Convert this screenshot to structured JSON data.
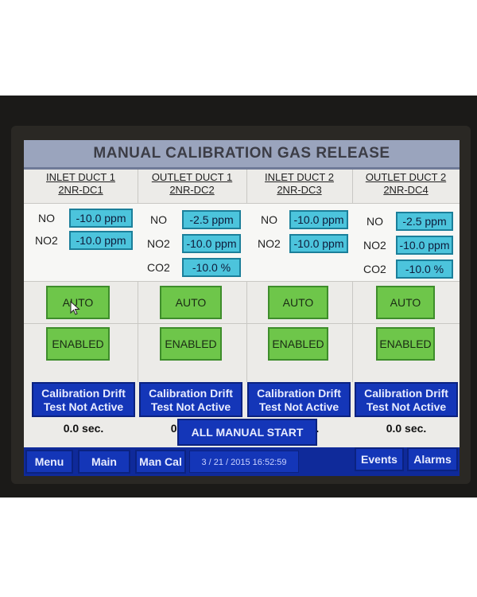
{
  "title": "MANUAL CALIBRATION GAS RELEASE",
  "ducts": [
    {
      "name": "INLET DUCT 1",
      "id": "2NR-DC1",
      "gases": [
        {
          "label": "NO",
          "value": "-10.0 ppm"
        },
        {
          "label": "NO2",
          "value": "-10.0 ppm"
        }
      ],
      "mode": "AUTO",
      "state": "ENABLED",
      "drift_status": [
        "Calibration Drift",
        "Test Not Active"
      ],
      "timer": "0.0 sec."
    },
    {
      "name": "OUTLET DUCT 1",
      "id": "2NR-DC2",
      "gases": [
        {
          "label": "NO",
          "value": "-2.5 ppm"
        },
        {
          "label": "NO2",
          "value": "-10.0 ppm"
        },
        {
          "label": "CO2",
          "value": "-10.0 %"
        }
      ],
      "mode": "AUTO",
      "state": "ENABLED",
      "drift_status": [
        "Calibration Drift",
        "Test Not Active"
      ],
      "timer": "0.0 sec."
    },
    {
      "name": "INLET DUCT 2",
      "id": "2NR-DC3",
      "gases": [
        {
          "label": "NO",
          "value": "-10.0 ppm"
        },
        {
          "label": "NO2",
          "value": "-10.0 ppm"
        }
      ],
      "mode": "AUTO",
      "state": "ENABLED",
      "drift_status": [
        "Calibration Drift",
        "Test Not Active"
      ],
      "timer": "0.0 sec."
    },
    {
      "name": "OUTLET DUCT 2",
      "id": "2NR-DC4",
      "gases": [
        {
          "label": "NO",
          "value": "-2.5 ppm"
        },
        {
          "label": "NO2",
          "value": "-10.0 ppm"
        },
        {
          "label": "CO2",
          "value": "-10.0 %"
        }
      ],
      "mode": "AUTO",
      "state": "ENABLED",
      "drift_status": [
        "Calibration Drift",
        "Test Not Active"
      ],
      "timer": "0.0 sec."
    }
  ],
  "all_manual_start": "ALL MANUAL START",
  "nav": {
    "menu": "Menu",
    "main": "Main",
    "man_cal": "Man Cal",
    "datetime": "3 / 21 / 2015  16:52:59",
    "events": "Events",
    "alarms": "Alarms"
  },
  "colors": {
    "title_bar": "#9aa4bd",
    "value_box": "#4cc4dc",
    "green_button": "#6ec64a",
    "blue_button": "#1436b8"
  },
  "icons": {
    "pointer": "mouse-cursor-icon"
  }
}
